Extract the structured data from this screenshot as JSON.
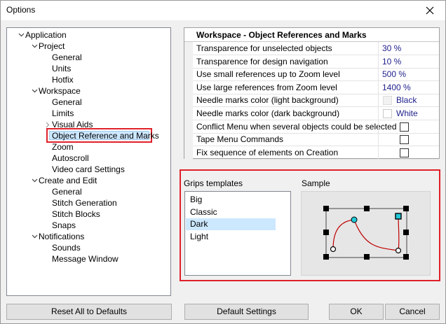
{
  "window": {
    "title": "Options"
  },
  "tree": [
    {
      "label": "Application",
      "level": 0,
      "expanded": true
    },
    {
      "label": "Project",
      "level": 1,
      "expanded": true
    },
    {
      "label": "General",
      "level": 2
    },
    {
      "label": "Units",
      "level": 2
    },
    {
      "label": "Hotfix",
      "level": 2
    },
    {
      "label": "Workspace",
      "level": 1,
      "expanded": true
    },
    {
      "label": "General",
      "level": 2
    },
    {
      "label": "Limits",
      "level": 2
    },
    {
      "label": "Visual Aids",
      "level": 2,
      "collapsed": true
    },
    {
      "label": "Object Reference and Marks",
      "level": 2,
      "selected": true
    },
    {
      "label": "Zoom",
      "level": 2
    },
    {
      "label": "Autoscroll",
      "level": 2
    },
    {
      "label": "Video card Settings",
      "level": 2
    },
    {
      "label": "Create and Edit",
      "level": 1,
      "expanded": true
    },
    {
      "label": "General",
      "level": 2
    },
    {
      "label": "Stitch Generation",
      "level": 2
    },
    {
      "label": "Stitch Blocks",
      "level": 2
    },
    {
      "label": "Snaps",
      "level": 2
    },
    {
      "label": "Notifications",
      "level": 1,
      "expanded": true
    },
    {
      "label": "Sounds",
      "level": 2
    },
    {
      "label": "Message Window",
      "level": 2
    }
  ],
  "grid": {
    "title": "Workspace - Object References and Marks",
    "rows": [
      {
        "name": "Transparence for unselected objects",
        "type": "text",
        "value": "30 %"
      },
      {
        "name": "Transparence for design navigation",
        "type": "text",
        "value": "10 %"
      },
      {
        "name": "Use small references up to Zoom level",
        "type": "text",
        "value": "500 %"
      },
      {
        "name": "Use large references from Zoom level",
        "type": "text",
        "value": "1400 %"
      },
      {
        "name": "Needle marks color (light background)",
        "type": "color",
        "value": "Black"
      },
      {
        "name": "Needle marks color (dark background)",
        "type": "color",
        "value": "White"
      },
      {
        "name": "Conflict Menu when several objects could be selected",
        "type": "check",
        "checked": false
      },
      {
        "name": "Tape Menu Commands",
        "type": "check",
        "checked": false
      },
      {
        "name": "Fix sequence of elements on Creation",
        "type": "check",
        "checked": false
      }
    ]
  },
  "grips": {
    "label": "Grips templates",
    "items": [
      "Big",
      "Classic",
      "Dark",
      "Light"
    ],
    "selected": "Dark",
    "sample_label": "Sample"
  },
  "buttons": {
    "reset": "Reset All to Defaults",
    "defaults": "Default Settings",
    "ok": "OK",
    "cancel": "Cancel"
  },
  "colors": {
    "highlight_frame": "#e0202a",
    "selection": "#cce8ff",
    "value_text": "#1e1e8c",
    "curve": "#c00000",
    "grip_accent": "#22c8d8"
  },
  "icons": {
    "close": "close-icon",
    "expand": "chevron-down-icon",
    "collapse": "chevron-right-icon"
  }
}
